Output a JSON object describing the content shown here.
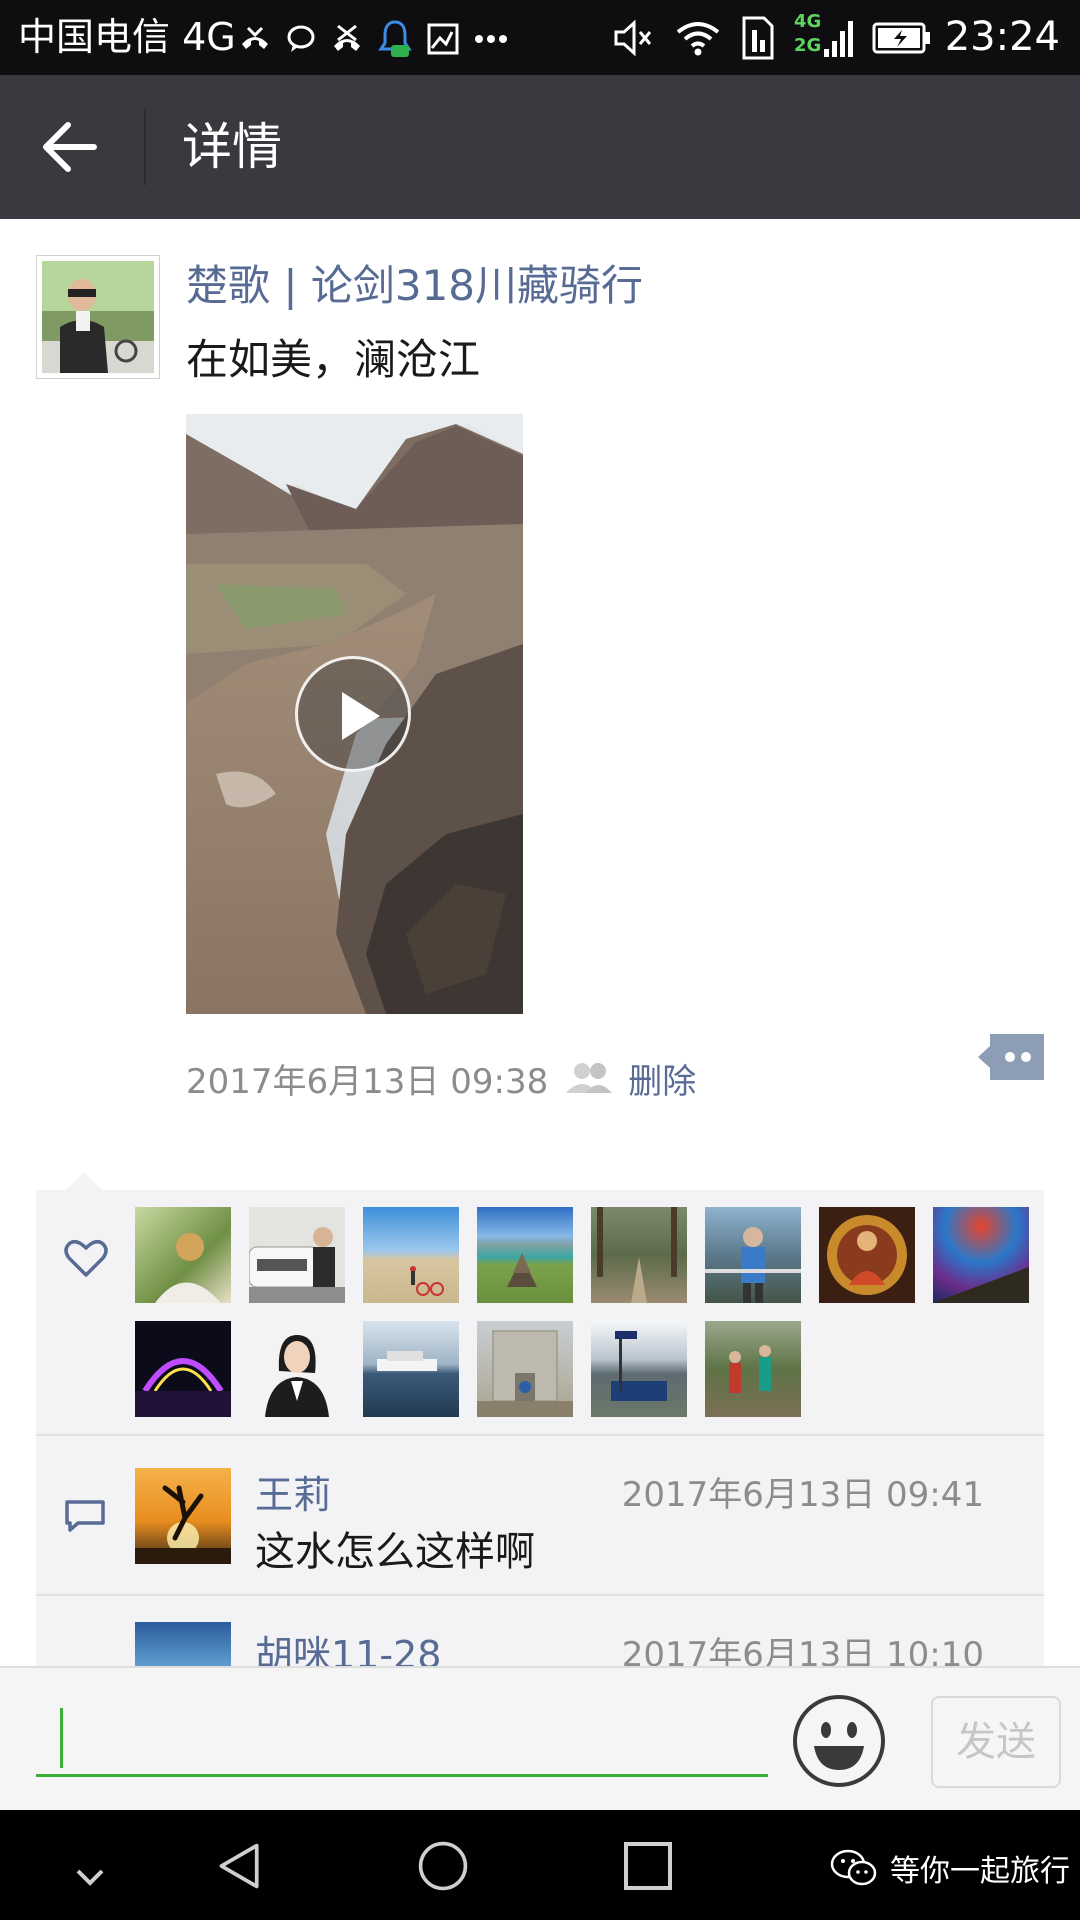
{
  "status_bar": {
    "carrier": "中国电信 4G",
    "time": "23:24",
    "network_badge_top": "4G",
    "network_badge_bottom": "2G"
  },
  "header": {
    "title": "详情"
  },
  "post": {
    "author": "楚歌 | 论剑318川藏骑行",
    "text": "在如美，澜沧江",
    "time": "2017年6月13日 09:38",
    "delete_label": "删除"
  },
  "likes": {
    "avatars": [
      "liker-1",
      "liker-2",
      "liker-3",
      "liker-4",
      "liker-5",
      "liker-6",
      "liker-7",
      "liker-8",
      "liker-9",
      "liker-10",
      "liker-11",
      "liker-12",
      "liker-13",
      "liker-14"
    ]
  },
  "comments": [
    {
      "name": "王莉",
      "time": "2017年6月13日 09:41",
      "text": "这水怎么这样啊"
    },
    {
      "name": "胡咪11-28",
      "time": "2017年6月13日 10:10",
      "text": ""
    }
  ],
  "input": {
    "value": "",
    "send_label": "发送"
  },
  "watermark": {
    "text": "等你一起旅行"
  },
  "icons": {
    "back": "back-arrow-icon",
    "heart": "heart-icon",
    "comment": "comment-icon",
    "emoji": "emoji-icon",
    "play": "play-icon",
    "more": "more-icon"
  },
  "colors": {
    "link": "#576b95",
    "header_bg": "#393a3f",
    "accent_green": "#3cb034"
  }
}
